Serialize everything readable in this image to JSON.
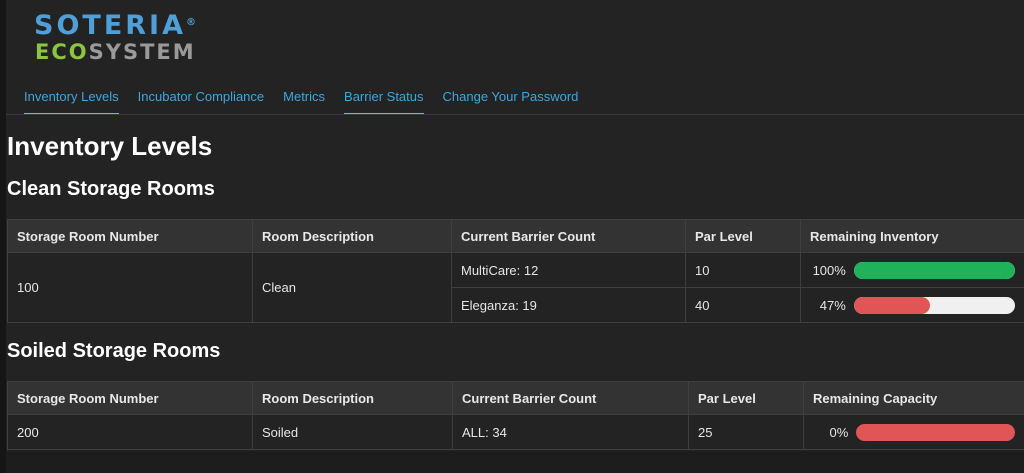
{
  "logo": {
    "line1": "SOTERIA",
    "reg": "®",
    "eco": "ECO",
    "system": "SYSTEM"
  },
  "nav": {
    "items": [
      {
        "label": "Inventory Levels",
        "active": true
      },
      {
        "label": "Incubator Compliance",
        "active": false
      },
      {
        "label": "Metrics",
        "active": false
      },
      {
        "label": "Barrier Status",
        "active": true
      },
      {
        "label": "Change Your Password",
        "active": false
      }
    ]
  },
  "page": {
    "title": "Inventory Levels"
  },
  "clean": {
    "title": "Clean Storage Rooms",
    "headers": [
      "Storage Room Number",
      "Room Description",
      "Current Barrier Count",
      "Par Level",
      "Remaining Inventory"
    ],
    "room": "100",
    "description": "Clean",
    "rows": [
      {
        "count": "MultiCare: 12",
        "par": "10",
        "pct_label": "100%",
        "pct": 1.0,
        "color": "#1fb25a"
      },
      {
        "count": "Eleganza: 19",
        "par": "40",
        "pct_label": "47%",
        "pct": 0.47,
        "color": "#e05555"
      }
    ]
  },
  "soiled": {
    "title": "Soiled Storage Rooms",
    "headers": [
      "Storage Room Number",
      "Room Description",
      "Current Barrier Count",
      "Par Level",
      "Remaining Capacity"
    ],
    "rows": [
      {
        "room": "200",
        "description": "Soiled",
        "count": "ALL: 34",
        "par": "25",
        "pct_label": "0%",
        "bar_color": "#e05555"
      }
    ]
  },
  "colors": {
    "accent_blue": "#3ea6df",
    "accent_green": "#8cc540",
    "bar_green": "#1fb25a",
    "bar_red": "#e05555"
  }
}
